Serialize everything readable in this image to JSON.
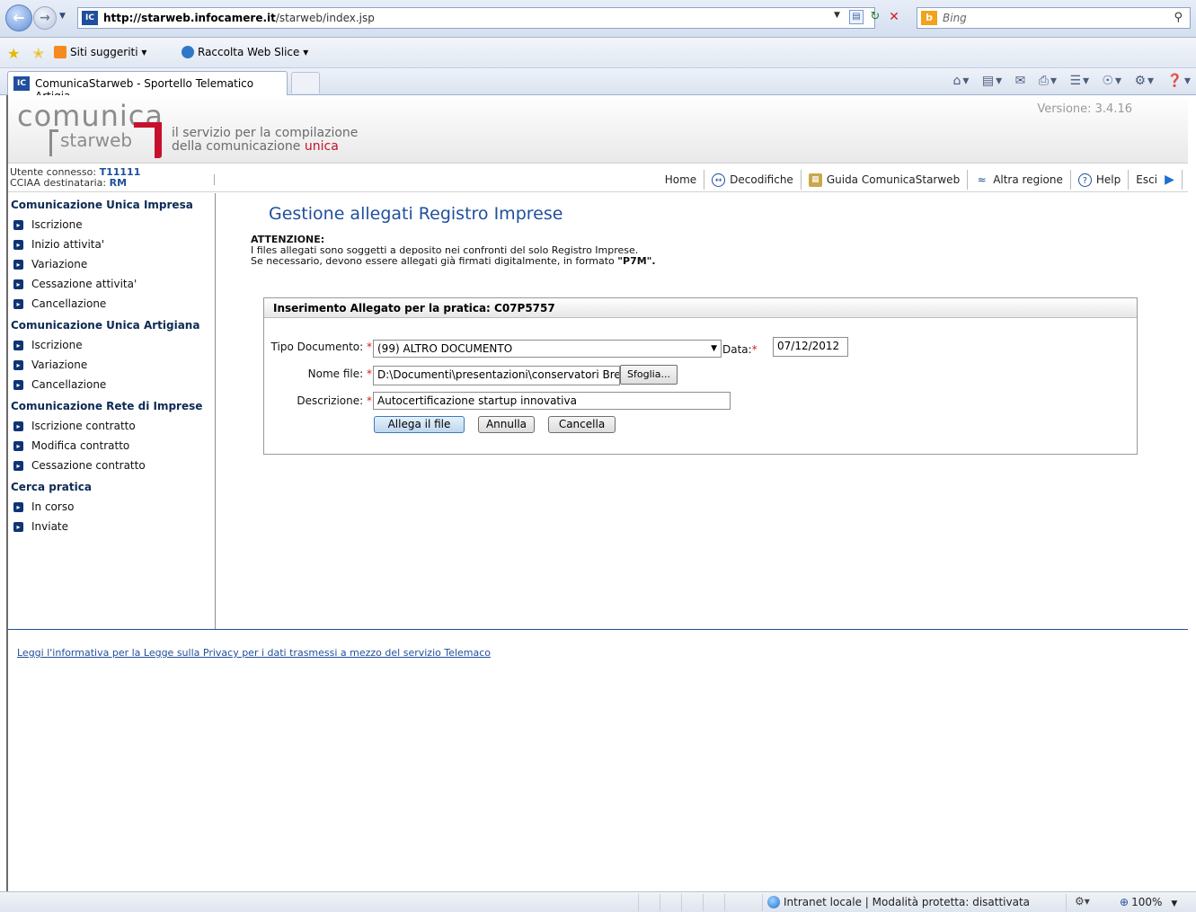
{
  "browser": {
    "url_domain": "http://starweb.infocamere.it",
    "url_path": "/starweb/index.jsp",
    "search_engine": "Bing",
    "favorites": {
      "suggested_sites": "Siti suggeriti",
      "web_slice": "Raccolta Web Slice"
    },
    "tab_title": "ComunicaStarweb - Sportello Telematico Artigia..."
  },
  "header": {
    "logo_main": "comunica",
    "logo_sub": "starweb",
    "tagline_line1": "il servizio per la compilazione",
    "tagline_line2_prefix": "della comunicazione ",
    "tagline_line2_highlight": "unica",
    "version": "Versione: 3.4.16"
  },
  "user": {
    "connected_label": "Utente connesso: ",
    "connected_value": "T11111",
    "cciaa_label": "CCIAA destinataria: ",
    "cciaa_value": "RM"
  },
  "topnav": {
    "home": "Home",
    "decodifiche": "Decodifiche",
    "guida": "Guida ComunicaStarweb",
    "altra_regione": "Altra regione",
    "help": "Help",
    "esci": "Esci"
  },
  "sidebar": {
    "sections": [
      {
        "title": "Comunicazione Unica Impresa",
        "items": [
          "Iscrizione",
          "Inizio attivita'",
          "Variazione",
          "Cessazione attivita'",
          "Cancellazione"
        ]
      },
      {
        "title": "Comunicazione Unica Artigiana",
        "items": [
          "Iscrizione",
          "Variazione",
          "Cancellazione"
        ]
      },
      {
        "title": "Comunicazione Rete di Imprese",
        "items": [
          "Iscrizione contratto",
          "Modifica contratto",
          "Cessazione contratto"
        ]
      },
      {
        "title": "Cerca pratica",
        "items": [
          "In corso",
          "Inviate"
        ]
      }
    ]
  },
  "main": {
    "title": "Gestione allegati Registro Imprese",
    "warning_title": "ATTENZIONE:",
    "warning_line1": "I files allegati sono soggetti a deposito nei confronti del solo Registro Imprese.",
    "warning_line2_prefix": "Se necessario, devono essere allegati già firmati digitalmente, in formato ",
    "warning_line2_format": "\"P7M\".",
    "form": {
      "header": "Inserimento Allegato per la pratica: C07P5757",
      "tipo_label": "Tipo Documento:",
      "tipo_value": "(99) ALTRO DOCUMENTO",
      "data_label": "Data:",
      "data_value": "07/12/2012",
      "nome_label": "Nome file:",
      "nome_value": "D:\\Documenti\\presentazioni\\conservatori Bre",
      "browse_button": "Sfoglia...",
      "desc_label": "Descrizione:",
      "desc_value": "Autocertificazione startup innovativa",
      "required_marker": "*",
      "btn_allega": "Allega il file",
      "btn_annulla": "Annulla",
      "btn_cancella": "Cancella"
    }
  },
  "footer": {
    "privacy_link": "Leggi l'informativa per la Legge sulla Privacy per i dati trasmessi a mezzo del servizio Telemaco"
  },
  "statusbar": {
    "zone": "Intranet locale | Modalità protetta: disattivata",
    "zoom": "100%"
  }
}
